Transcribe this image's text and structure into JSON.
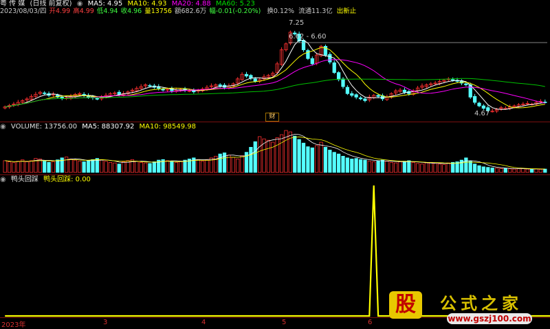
{
  "header": {
    "stock": "粤 传 媒",
    "mode": "(日线 前复权)",
    "ma5": "MA5: 4.95",
    "ma10": "MA10: 4.93",
    "ma20": "MA20: 4.88",
    "ma60": "MA60: 5.23",
    "date": "2023/08/03/四",
    "open": "开4.99",
    "high": "高4.99",
    "low": "低4.94",
    "close": "收4.96",
    "vol": "量13756",
    "amount": "额682.6万",
    "change": "幅-0.01(-0.20%)",
    "turnover": "换0.12%",
    "float": "流通11.3亿",
    "signal": "出新止"
  },
  "volume_header": {
    "title": "VOLUME: 13756.00",
    "ma5": "MA5: 88307.92",
    "ma10": "MA10: 98549.98"
  },
  "indicator_header": {
    "title": "鸭头回踩",
    "value": "鸭头回踩: 0.00"
  },
  "annotations": {
    "peak": "7.25",
    "range": "6.62 - 6.60",
    "low": "4.67",
    "badge": "财"
  },
  "x_axis": [
    "2023年",
    "3",
    "4",
    "5",
    "6"
  ],
  "logo": {
    "gu": "股",
    "title": "公式之家",
    "url": "www.gszj100.com"
  },
  "colors": {
    "up": "#ff3030",
    "down": "#54ffff",
    "ma5": "#ffffff",
    "ma10": "#ffff00",
    "ma20": "#ff00ff",
    "ma60": "#00c000",
    "signal": "#ffff00"
  },
  "chart_data": [
    {
      "type": "candlestick",
      "title": "粤 传 媒 (日线 前复权)",
      "ylim": [
        4.5,
        7.4
      ],
      "close": [
        4.82,
        4.86,
        4.9,
        4.95,
        5.0,
        5.05,
        5.12,
        5.18,
        5.24,
        5.2,
        5.15,
        5.18,
        5.1,
        5.06,
        5.08,
        5.12,
        5.18,
        5.2,
        5.14,
        5.1,
        5.08,
        5.05,
        5.1,
        5.15,
        5.2,
        5.22,
        5.18,
        5.2,
        5.25,
        5.3,
        5.35,
        5.4,
        5.45,
        5.42,
        5.38,
        5.35,
        5.3,
        5.32,
        5.28,
        5.3,
        5.32,
        5.3,
        5.28,
        5.25,
        5.3,
        5.33,
        5.38,
        5.42,
        5.45,
        5.42,
        5.38,
        5.42,
        5.48,
        5.62,
        5.75,
        5.7,
        5.64,
        5.55,
        5.6,
        5.68,
        5.72,
        5.78,
        6.05,
        6.45,
        6.62,
        6.95,
        6.9,
        6.7,
        6.45,
        6.2,
        6.05,
        6.3,
        6.55,
        6.3,
        6.1,
        5.8,
        5.6,
        5.4,
        5.2,
        5.15,
        5.1,
        5.05,
        5.0,
        5.1,
        5.15,
        5.12,
        5.05,
        5.1,
        5.2,
        5.28,
        5.3,
        5.24,
        5.2,
        5.28,
        5.36,
        5.42,
        5.45,
        5.48,
        5.5,
        5.55,
        5.58,
        5.62,
        5.58,
        5.55,
        5.5,
        5.45,
        5.1,
        4.95,
        4.85,
        4.78,
        4.72,
        4.7,
        4.75,
        4.8,
        4.78,
        4.82,
        4.85,
        4.88,
        4.9,
        4.92,
        4.9,
        4.95,
        4.98,
        4.96
      ]
    },
    {
      "type": "bar",
      "title": "VOLUME",
      "values": [
        42,
        38,
        35,
        40,
        45,
        38,
        42,
        50,
        48,
        40,
        36,
        38,
        45,
        52,
        55,
        48,
        44,
        40,
        38,
        42,
        46,
        50,
        44,
        40,
        36,
        34,
        30,
        38,
        42,
        46,
        40,
        36,
        34,
        32,
        38,
        44,
        46,
        42,
        38,
        36,
        40,
        44,
        48,
        52,
        46,
        40,
        44,
        52,
        58,
        66,
        70,
        62,
        54,
        48,
        60,
        72,
        90,
        110,
        128,
        120,
        115,
        108,
        124,
        135,
        150,
        145,
        130,
        118,
        105,
        92,
        88,
        96,
        108,
        90,
        80,
        72,
        66,
        58,
        52,
        48,
        50,
        46,
        44,
        40,
        38,
        42,
        44,
        40,
        36,
        34,
        38,
        40,
        42,
        36,
        32,
        30,
        34,
        36,
        32,
        30,
        28,
        34,
        36,
        38,
        44,
        52,
        40,
        30,
        24,
        20,
        18,
        16,
        15,
        14,
        14,
        13,
        12,
        13,
        14,
        12,
        11,
        12,
        11,
        12
      ]
    },
    {
      "type": "line",
      "title": "鸭头回踩",
      "values": [
        0,
        0,
        0,
        0,
        0,
        0,
        0,
        0,
        0,
        0,
        0,
        0,
        0,
        0,
        0,
        0,
        0,
        0,
        0,
        0,
        0,
        0,
        0,
        0,
        0,
        0,
        0,
        0,
        0,
        0,
        0,
        0,
        0,
        0,
        0,
        0,
        0,
        0,
        0,
        0,
        0,
        0,
        0,
        0,
        0,
        0,
        0,
        0,
        0,
        0,
        0,
        0,
        0,
        0,
        0,
        0,
        0,
        0,
        0,
        0,
        0,
        0,
        0,
        0,
        0,
        0,
        0,
        0,
        0,
        0,
        0,
        0,
        0,
        0,
        0,
        0,
        0,
        0,
        0,
        0,
        0,
        0,
        0,
        0,
        1,
        0,
        0,
        0,
        0,
        0,
        0,
        0,
        0,
        0,
        0,
        0,
        0,
        0,
        0,
        0,
        0,
        0,
        0,
        0,
        0,
        0,
        0,
        0,
        0,
        0,
        0,
        0,
        0,
        0,
        0,
        0,
        0,
        0,
        0,
        0,
        0,
        0,
        0,
        0,
        0,
        0,
        0
      ]
    }
  ]
}
